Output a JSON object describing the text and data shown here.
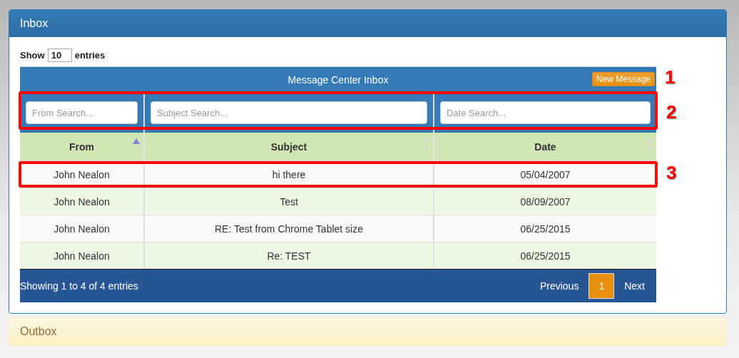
{
  "inbox_panel": {
    "title": "Inbox",
    "expanded": true
  },
  "length_control": {
    "label_before": "Show",
    "value": "10",
    "label_after": "entries"
  },
  "table": {
    "title": "Message Center Inbox",
    "new_button": "New Message",
    "filters": [
      {
        "placeholder": "From Search..."
      },
      {
        "placeholder": "Subject Search..."
      },
      {
        "placeholder": "Date Search..."
      }
    ],
    "columns": [
      {
        "label": "From",
        "sorted": true
      },
      {
        "label": "Subject",
        "sorted": false
      },
      {
        "label": "Date",
        "sorted": false
      }
    ],
    "rows": [
      {
        "cells": [
          "John Nealon",
          "hi there",
          "05/04/2007"
        ]
      },
      {
        "cells": [
          "John Nealon",
          "Test",
          "08/09/2007"
        ]
      },
      {
        "cells": [
          "John Nealon",
          "RE: Test from Chrome Tablet size",
          "06/25/2015"
        ]
      },
      {
        "cells": [
          "John Nealon",
          "Re: TEST",
          "06/25/2015"
        ]
      }
    ],
    "info": "Showing 1 to 4 of 4 entries",
    "pagination": [
      {
        "label": "Previous",
        "selected": false
      },
      {
        "label": "1",
        "selected": true
      },
      {
        "label": "Next",
        "selected": false
      }
    ]
  },
  "annotations": [
    {
      "number": "1",
      "kind": "number"
    },
    {
      "number": "2",
      "kind": "framed"
    },
    {
      "number": "3",
      "kind": "framed"
    }
  ],
  "outbox_panel": {
    "title": "Outbox"
  }
}
